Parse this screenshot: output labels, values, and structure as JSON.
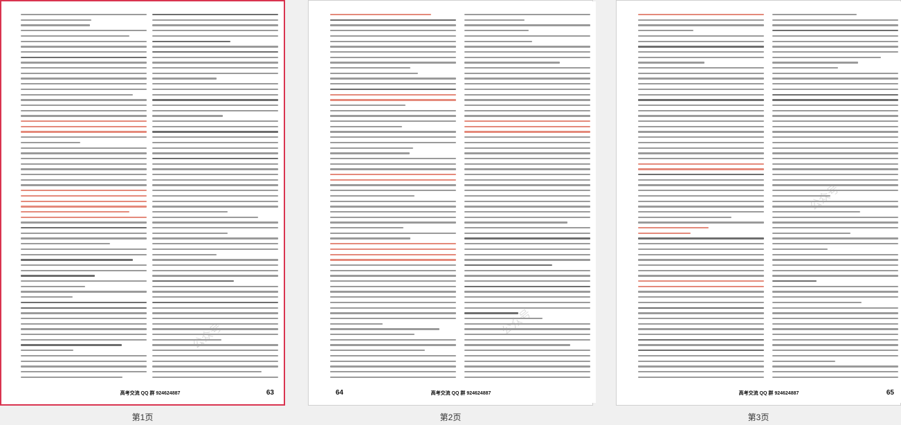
{
  "viewer": {
    "pages": [
      {
        "caption": "第1页",
        "page_number": "63",
        "brand": "高考交流 QQ 群 924624887",
        "selected": true
      },
      {
        "caption": "第2页",
        "page_number": "64",
        "brand": "高考交流 QQ 群 924624887",
        "selected": false
      },
      {
        "caption": "第3页",
        "page_number": "65",
        "brand": "高考交流 QQ 群 924624887",
        "selected": false
      }
    ],
    "watermark_text": "公众号"
  },
  "colors": {
    "selected_border": "#d9334f",
    "answer_highlight": "#e4897a",
    "background": "#f0f0f0"
  }
}
